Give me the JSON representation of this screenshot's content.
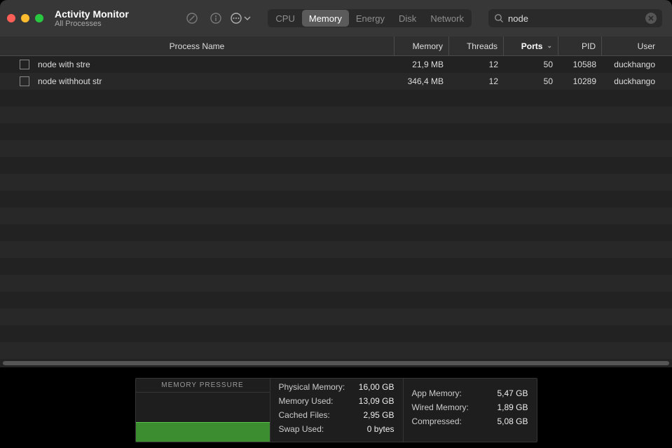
{
  "window": {
    "title": "Activity Monitor",
    "subtitle": "All Processes"
  },
  "tabs": [
    {
      "label": "CPU",
      "active": false
    },
    {
      "label": "Memory",
      "active": true
    },
    {
      "label": "Energy",
      "active": false
    },
    {
      "label": "Disk",
      "active": false
    },
    {
      "label": "Network",
      "active": false
    }
  ],
  "search": {
    "value": "node"
  },
  "columns": {
    "name": "Process Name",
    "memory": "Memory",
    "threads": "Threads",
    "ports": "Ports",
    "pid": "PID",
    "user": "User",
    "sorted_column": "ports",
    "sort_dir": "desc"
  },
  "rows": [
    {
      "name": "node with stre",
      "memory": "21,9 MB",
      "threads": "12",
      "ports": "50",
      "pid": "10588",
      "user": "duckhango"
    },
    {
      "name": "node withhout str",
      "memory": "346,4 MB",
      "threads": "12",
      "ports": "50",
      "pid": "10289",
      "user": "duckhango"
    }
  ],
  "summary": {
    "pressure_label": "MEMORY PRESSURE",
    "left": {
      "physical_label": "Physical Memory:",
      "physical_value": "16,00 GB",
      "used_label": "Memory Used:",
      "used_value": "13,09 GB",
      "cached_label": "Cached Files:",
      "cached_value": "2,95 GB",
      "swap_label": "Swap Used:",
      "swap_value": "0 bytes"
    },
    "right": {
      "app_label": "App Memory:",
      "app_value": "5,47 GB",
      "wired_label": "Wired Memory:",
      "wired_value": "1,89 GB",
      "compressed_label": "Compressed:",
      "compressed_value": "5,08 GB"
    }
  }
}
